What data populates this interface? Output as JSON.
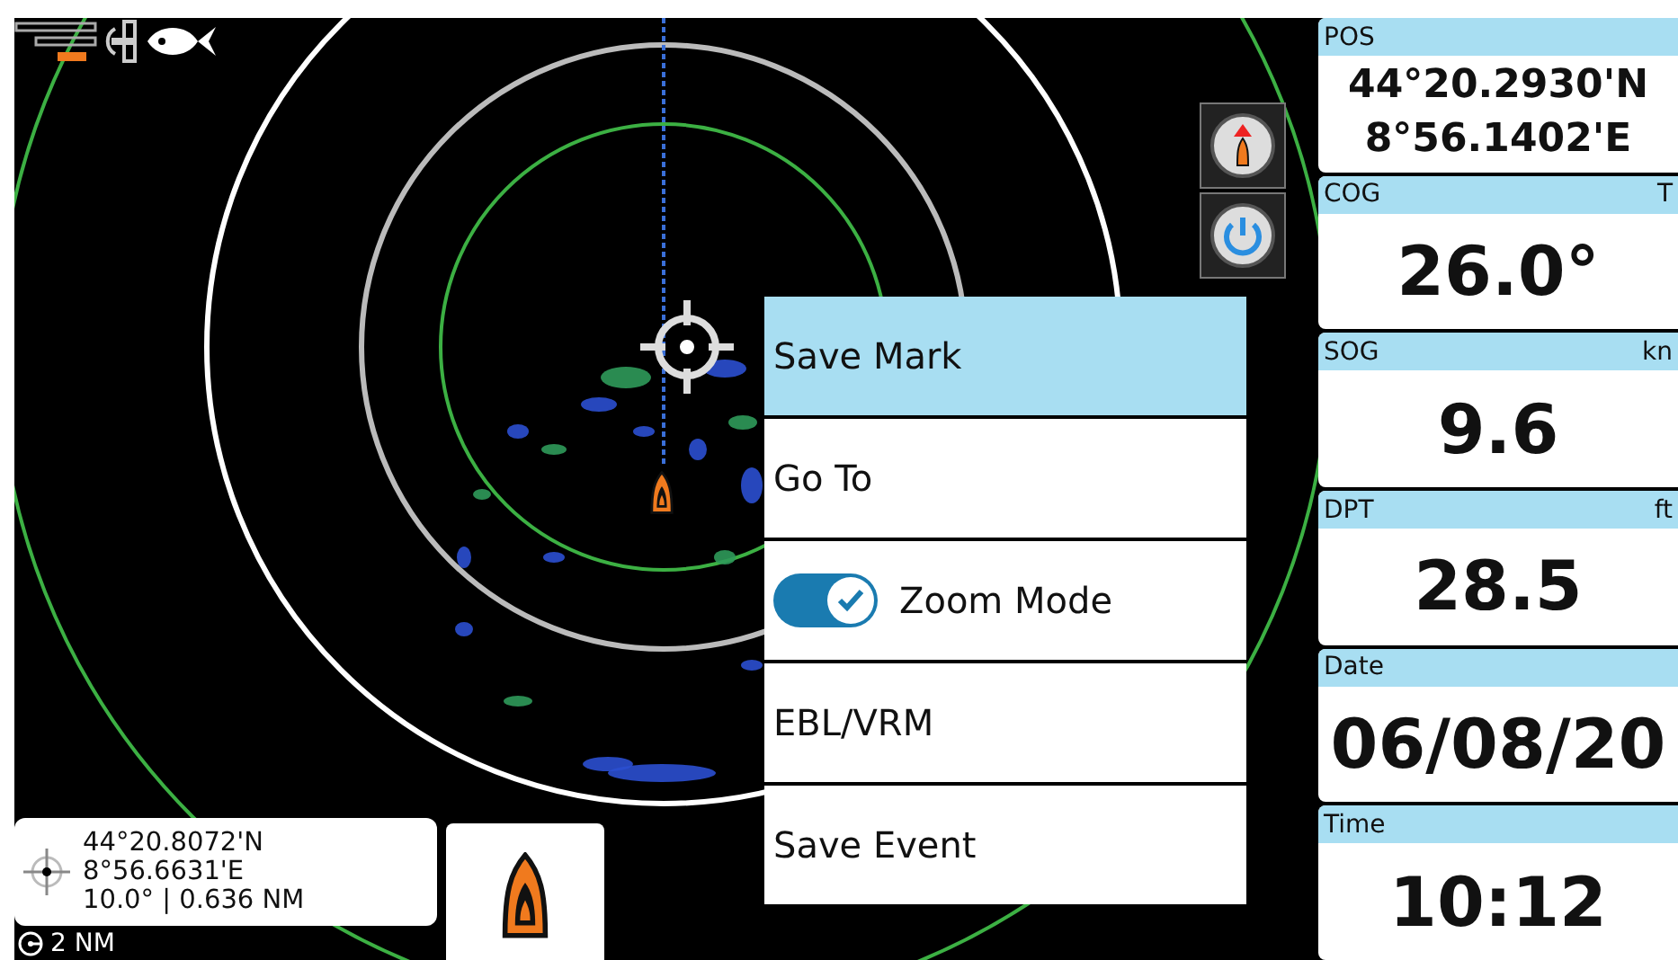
{
  "range": {
    "label": "2 NM"
  },
  "cursor_info": {
    "latitude": "44°20.8072'N",
    "longitude": "8°56.6631'E",
    "bearing_range": "10.0° | 0.636 NM"
  },
  "menu": {
    "items": [
      {
        "label": "Save Mark",
        "kind": "action",
        "selected": true
      },
      {
        "label": "Go To",
        "kind": "action",
        "selected": false
      },
      {
        "label": "Zoom Mode",
        "kind": "toggle",
        "selected": false,
        "checked": true
      },
      {
        "label": "EBL/VRM",
        "kind": "action",
        "selected": false
      },
      {
        "label": "Save Event",
        "kind": "action",
        "selected": false
      }
    ]
  },
  "data_panels": [
    {
      "title": "POS",
      "kind": "position",
      "lines": [
        "44°20.2930'N",
        "8°56.1402'E"
      ]
    },
    {
      "title": "COG",
      "unit": "T",
      "kind": "value",
      "lines": [
        "26.0°"
      ]
    },
    {
      "title": "SOG",
      "unit": "kn",
      "kind": "value",
      "lines": [
        "9.6"
      ]
    },
    {
      "title": "DPT",
      "unit": "ft",
      "kind": "value",
      "lines": [
        "28.5"
      ]
    },
    {
      "title": "Date",
      "kind": "value",
      "lines": [
        "06/08/20"
      ]
    },
    {
      "title": "Time",
      "kind": "value",
      "lines": [
        "10:12"
      ]
    }
  ]
}
